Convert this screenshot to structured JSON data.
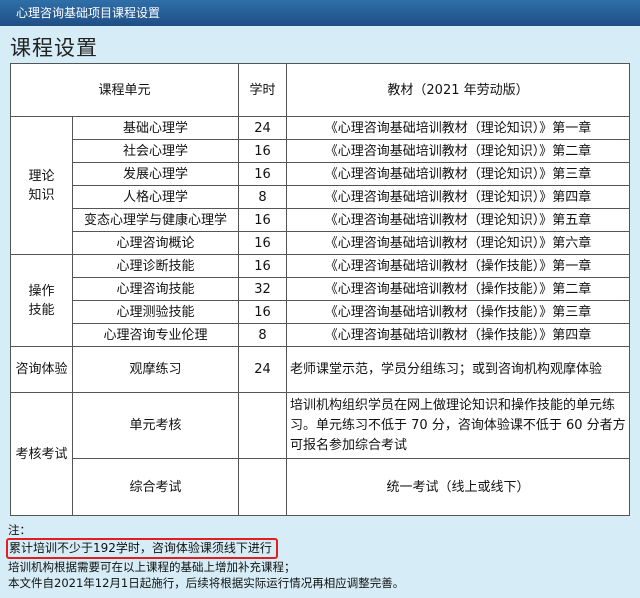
{
  "window": {
    "title": "心理咨询基础项目课程设置"
  },
  "page": {
    "title": "课程设置"
  },
  "table": {
    "headers": {
      "unit": "课程单元",
      "hours": "学时",
      "textbook": "教材（2021 年劳动版）"
    },
    "theory": {
      "category": "理论知识",
      "rows": [
        {
          "unit": "基础心理学",
          "hours": "24",
          "textbook": "《心理咨询基础培训教材（理论知识）》第一章"
        },
        {
          "unit": "社会心理学",
          "hours": "16",
          "textbook": "《心理咨询基础培训教材（理论知识）》第二章"
        },
        {
          "unit": "发展心理学",
          "hours": "16",
          "textbook": "《心理咨询基础培训教材（理论知识）》第三章"
        },
        {
          "unit": "人格心理学",
          "hours": "8",
          "textbook": "《心理咨询基础培训教材（理论知识）》第四章"
        },
        {
          "unit": "变态心理学与健康心理学",
          "hours": "16",
          "textbook": "《心理咨询基础培训教材（理论知识）》第五章"
        },
        {
          "unit": "心理咨询概论",
          "hours": "16",
          "textbook": "《心理咨询基础培训教材（理论知识）》第六章"
        }
      ]
    },
    "skills": {
      "category": "操作技能",
      "rows": [
        {
          "unit": "心理诊断技能",
          "hours": "16",
          "textbook": "《心理咨询基础培训教材（操作技能）》第一章"
        },
        {
          "unit": "心理咨询技能",
          "hours": "32",
          "textbook": "《心理咨询基础培训教材（操作技能）》第二章"
        },
        {
          "unit": "心理测验技能",
          "hours": "16",
          "textbook": "《心理咨询基础培训教材（操作技能）》第三章"
        },
        {
          "unit": "心理咨询专业伦理",
          "hours": "8",
          "textbook": "《心理咨询基础培训教材（操作技能）》第四章"
        }
      ]
    },
    "experience": {
      "category": "咨询体验",
      "unit": "观摩练习",
      "hours": "24",
      "textbook": "老师课堂示范，学员分组练习；或到咨询机构观摩体验"
    },
    "exam": {
      "category": "考核考试",
      "unit_exam": {
        "unit": "单元考核",
        "hours": "",
        "textbook": "培训机构组织学员在网上做理论知识和操作技能的单元练习。单元练习不低于 70 分，咨询体验课不低于 60 分者方可报名参加综合考试"
      },
      "final_exam": {
        "unit": "综合考试",
        "hours": "",
        "textbook": "统一考试（线上或线下）"
      }
    }
  },
  "notes": {
    "label": "注：",
    "highlight": "累计培训不少于192学时，咨询体验课须线下进行",
    "line2": "培训机构根据需要可在以上课程的基础上增加补充课程；",
    "line3": "本文件自2021年12月1日起施行，后续将根据实际运行情况再相应调整完善。"
  }
}
